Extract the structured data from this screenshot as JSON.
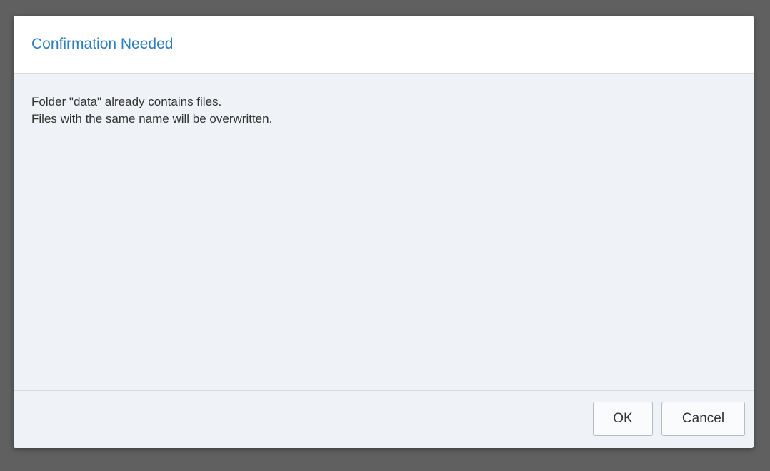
{
  "dialog": {
    "title": "Confirmation Needed",
    "message_lines": [
      "Folder \"data\" already contains files.",
      "Files with the same name will be overwritten."
    ],
    "buttons": {
      "ok_label": "OK",
      "cancel_label": "Cancel"
    }
  },
  "colors": {
    "title_accent": "#2d7dc1",
    "overlay": "#606061",
    "dialog_body": "#eff2f6"
  }
}
